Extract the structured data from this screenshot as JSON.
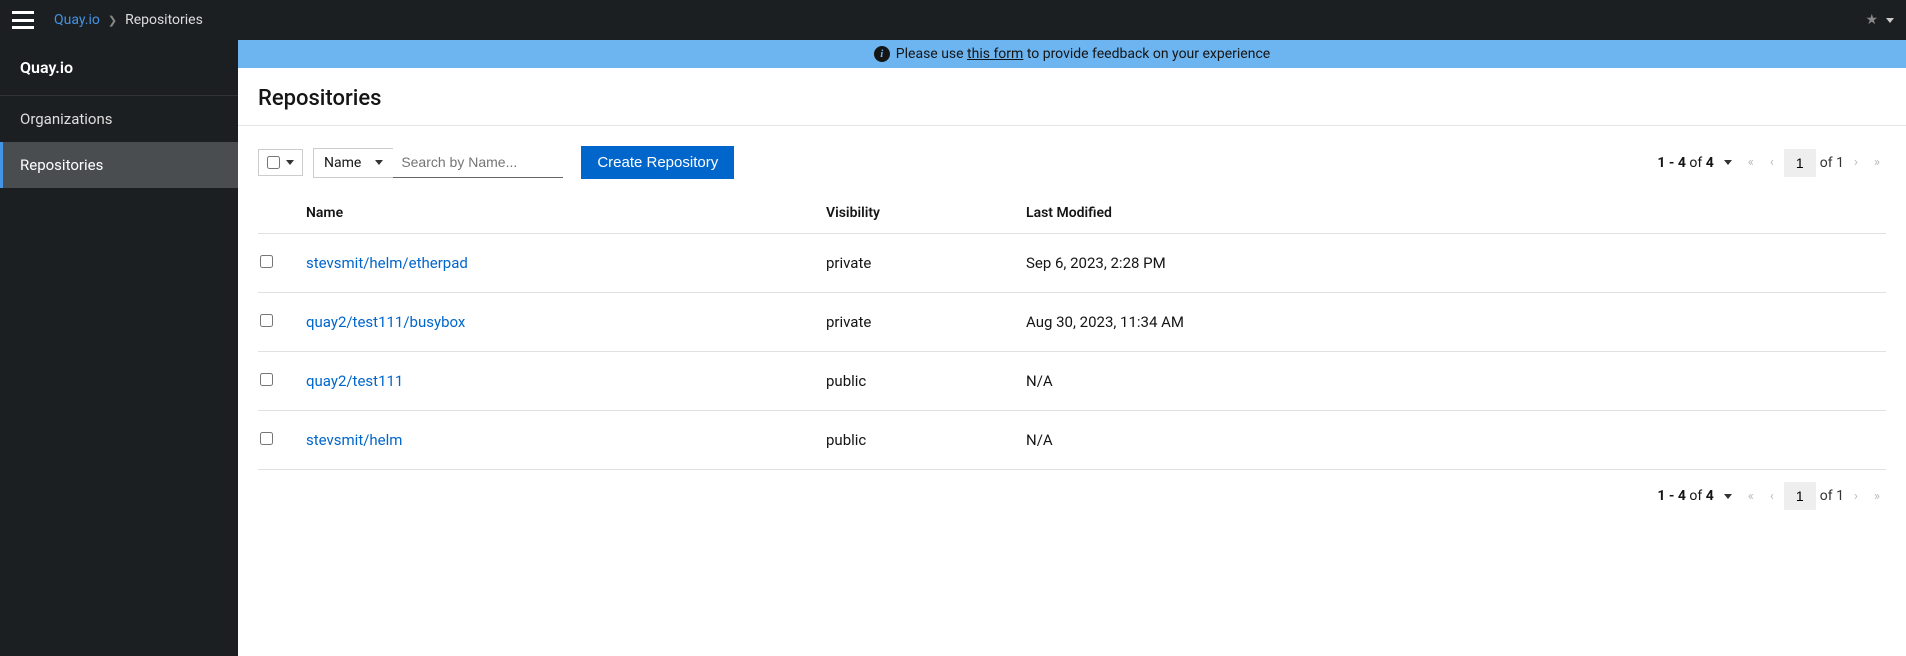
{
  "breadcrumb": {
    "root": "Quay.io",
    "current": "Repositories"
  },
  "sidebar": {
    "title": "Quay.io",
    "items": [
      {
        "label": "Organizations",
        "active": false
      },
      {
        "label": "Repositories",
        "active": true
      }
    ]
  },
  "notice": {
    "prefix": "Please use",
    "link": "this form",
    "suffix": "to provide feedback on your experience"
  },
  "page": {
    "title": "Repositories"
  },
  "toolbar": {
    "filter_label": "Name",
    "search_placeholder": "Search by Name...",
    "create_label": "Create Repository"
  },
  "pagination": {
    "range": "1 - 4",
    "of_word": "of",
    "total": "4",
    "page_value": "1",
    "of_pages_word": "of",
    "total_pages": "1"
  },
  "table": {
    "columns": {
      "name": "Name",
      "visibility": "Visibility",
      "last_modified": "Last Modified"
    },
    "rows": [
      {
        "name": "stevsmit/helm/etherpad",
        "visibility": "private",
        "last_modified": "Sep 6, 2023, 2:28 PM"
      },
      {
        "name": "quay2/test111/busybox",
        "visibility": "private",
        "last_modified": "Aug 30, 2023, 11:34 AM"
      },
      {
        "name": "quay2/test111",
        "visibility": "public",
        "last_modified": "N/A"
      },
      {
        "name": "stevsmit/helm",
        "visibility": "public",
        "last_modified": "N/A"
      }
    ]
  }
}
